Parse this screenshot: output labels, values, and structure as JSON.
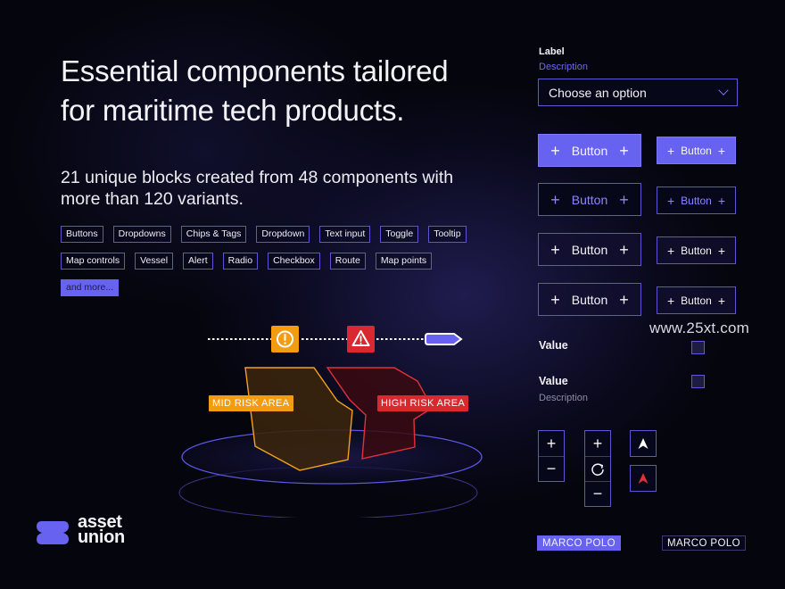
{
  "headline": {
    "line1": "Essential components tailored",
    "line2": "for maritime tech products."
  },
  "subhead": {
    "line1": "21 unique blocks created from 48 components with",
    "line2": "more than 120 variants."
  },
  "tags": [
    "Buttons",
    "Dropdowns",
    "Chips & Tags",
    "Dropdown",
    "Text input",
    "Toggle",
    "Tooltip",
    "Map controls",
    "Vessel",
    "Alert",
    "Radio",
    "Checkbox",
    "Route",
    "Map points"
  ],
  "more_tag": "and more...",
  "dropdown": {
    "label": "Label",
    "description": "Description",
    "value": "Choose an option"
  },
  "buttons": {
    "label": "Button",
    "variants": [
      "primary",
      "secondary",
      "tertiary",
      "outline"
    ]
  },
  "checkboxes": [
    {
      "label": "Value",
      "checked": false
    },
    {
      "label": "Value",
      "description": "Description",
      "checked": false
    }
  ],
  "map_controls": {
    "zoom_in": "+",
    "zoom_out": "−",
    "reset": "reset-rotation",
    "north_white": "north-arrow",
    "north_red": "north-arrow-active"
  },
  "chips": {
    "filled": "MARCO POLO",
    "outline": "MARCO POLO"
  },
  "illustration": {
    "mid_risk_label": "MID RISK AREA",
    "high_risk_label": "HIGH RISK AREA",
    "route_alerts": [
      "warning",
      "danger"
    ]
  },
  "logo": {
    "line1": "asset",
    "line2": "union"
  },
  "watermark": "www.25xt.com",
  "colors": {
    "accent": "#6762F0",
    "background": "#05050D",
    "warning": "#F39C12",
    "danger": "#D9282F"
  }
}
